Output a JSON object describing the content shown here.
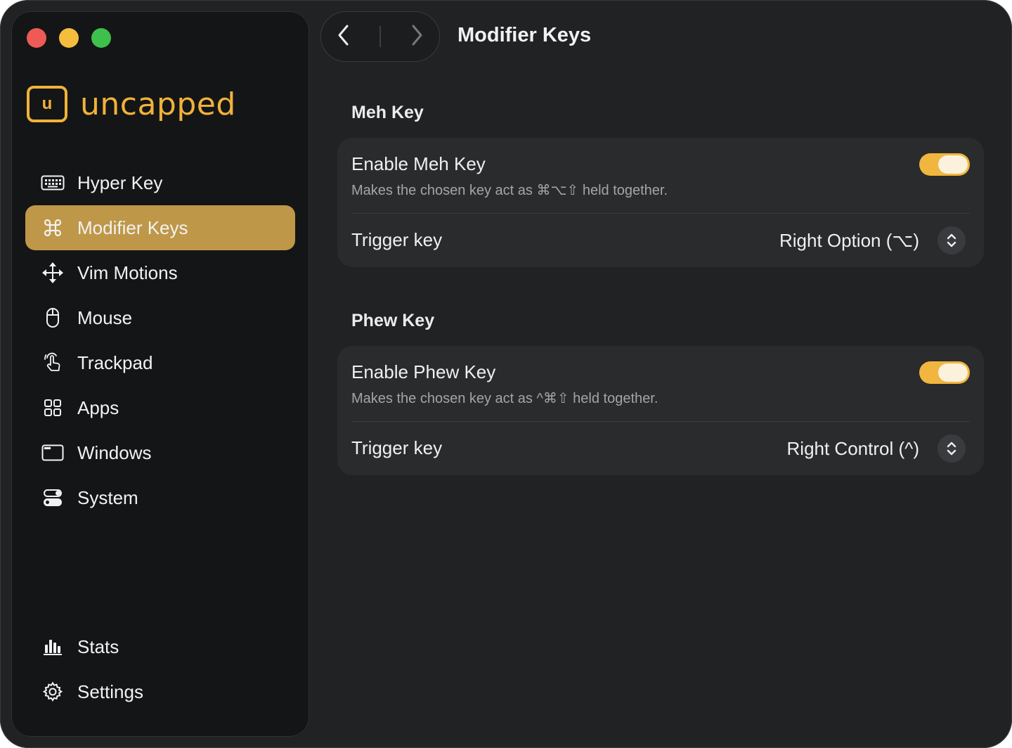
{
  "app": {
    "name": "uncapped",
    "logo_letter": "u"
  },
  "sidebar": {
    "items": [
      {
        "label": "Hyper Key",
        "icon": "keyboard-icon"
      },
      {
        "label": "Modifier Keys",
        "icon": "command-icon",
        "active": true
      },
      {
        "label": "Vim Motions",
        "icon": "move-arrows-icon"
      },
      {
        "label": "Mouse",
        "icon": "mouse-icon"
      },
      {
        "label": "Trackpad",
        "icon": "hand-pointer-icon"
      },
      {
        "label": "Apps",
        "icon": "apps-grid-icon"
      },
      {
        "label": "Windows",
        "icon": "window-icon"
      },
      {
        "label": "System",
        "icon": "toggles-icon"
      }
    ],
    "bottom_items": [
      {
        "label": "Stats",
        "icon": "bar-chart-icon"
      },
      {
        "label": "Settings",
        "icon": "gear-icon"
      }
    ]
  },
  "header": {
    "title": "Modifier Keys"
  },
  "sections": [
    {
      "title": "Meh Key",
      "enable_label": "Enable Meh Key",
      "description": "Makes the chosen key act as ⌘⌥⇧ held together.",
      "enabled": true,
      "trigger_label": "Trigger key",
      "trigger_value": "Right Option (⌥)"
    },
    {
      "title": "Phew Key",
      "enable_label": "Enable Phew Key",
      "description": "Makes the chosen key act as ^⌘⇧ held together.",
      "enabled": true,
      "trigger_label": "Trigger key",
      "trigger_value": "Right Control (^)"
    }
  ],
  "colors": {
    "accent": "#f0b23a",
    "active_item": "#bf9748",
    "toggle_on": "#f1b63f"
  }
}
